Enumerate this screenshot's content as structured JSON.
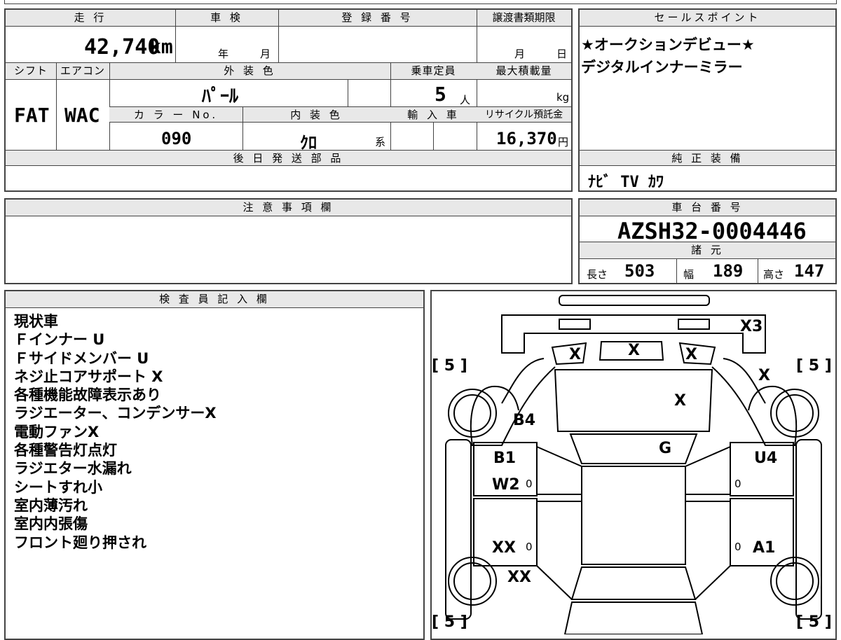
{
  "headers": {
    "mileage": "走 行",
    "inspection": "車 検",
    "registration_no": "登 録 番 号",
    "transfer_deadline": "譲渡書類期限",
    "sales_point": "セールスポイント",
    "shift": "シフト",
    "aircon": "エアコン",
    "exterior_color": "外 装 色",
    "capacity": "乗車定員",
    "max_load": "最大積載量",
    "color_no": "カ ラ ー No.",
    "interior_color": "内 装 色",
    "import": "輸 入 車",
    "recycle_fee": "リサイクル預託金",
    "later_parts": "後 日 発 送 部 品",
    "genuine_equipment": "純 正 装 備",
    "notes_field": "注 意 事 項 欄",
    "chassis_no": "車 台 番 号",
    "specs": "諸 元",
    "inspector_notes": "検 査 員 記 入 欄"
  },
  "values": {
    "mileage": "42,740",
    "mileage_unit": "km",
    "inspection_year_unit": "年",
    "inspection_month_unit": "月",
    "transfer_month_unit": "月",
    "transfer_day_unit": "日",
    "shift": "FAT",
    "aircon": "WAC",
    "exterior_color": "ﾊﾟｰﾙ",
    "capacity": "5",
    "capacity_unit": "人",
    "max_load_unit": "kg",
    "color_no": "090",
    "interior_color": "ｸﾛ",
    "interior_suffix": "系",
    "recycle_fee": "16,370",
    "recycle_unit": "円",
    "genuine_equipment": "ﾅﾋﾞ  TV  ｶﾜ",
    "chassis_no": "AZSH32-0004446",
    "length_label": "長さ",
    "length": "503",
    "width_label": "幅",
    "width": "189",
    "height_label": "高さ",
    "height": "147"
  },
  "sales_points": [
    "★オークションデビュー★",
    "デジタルインナーミラー"
  ],
  "inspector_notes": [
    "現状車",
    "Ｆインナー U",
    "Ｆサイドメンバー U",
    "ネジ止コアサポート X",
    "各種機能故障表示あり",
    "ラジエーター、コンデンサーX",
    "電動ファンX",
    "各種警告灯点灯",
    "ラジエター水漏れ",
    "シートすれ小",
    "室内薄汚れ",
    "室内内張傷",
    "フロント廻り押され"
  ],
  "diagram": {
    "marks": {
      "front_bumper": "X3",
      "grille_left": "X",
      "grille_center": "X",
      "grille_right": "X",
      "right_fender": "X",
      "hood": "X",
      "left_fender": "B4",
      "windshield": "G",
      "left_front_door": "B1",
      "left_front_door_2": "W2",
      "right_front_door": "U4",
      "left_rear_door": "XX",
      "right_rear_door": "A1",
      "left_rear_fender": "XX"
    },
    "tire_fl": "5",
    "tire_fr": "5",
    "tire_rl": "5",
    "tire_rr": "5",
    "zero_1": "0",
    "zero_2": "0",
    "zero_3": "0",
    "zero_4": "0"
  }
}
